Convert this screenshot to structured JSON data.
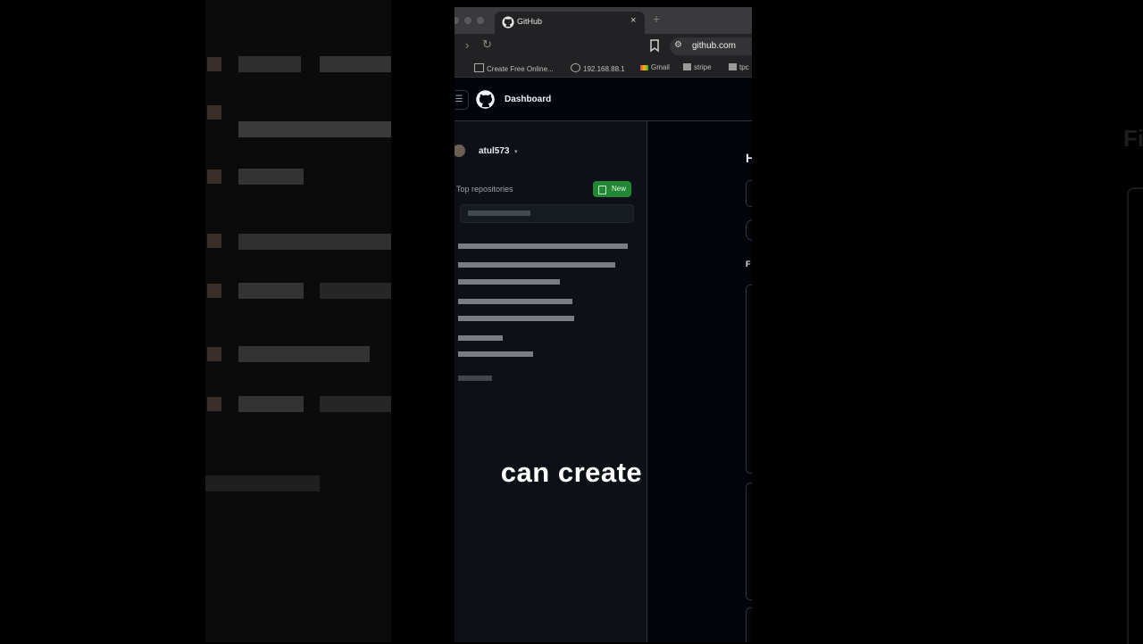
{
  "browser": {
    "tab_title": "GitHub",
    "tab_close": "×",
    "new_tab": "+",
    "forward": "›",
    "reload": "↻",
    "url": "github.com",
    "url_icon": "⚙",
    "bookmarks": [
      {
        "label": "Create Free Online...",
        "icon": "page-icon"
      },
      {
        "label": "192.168.88.1",
        "icon": "globe-icon"
      },
      {
        "label": "Gmail",
        "icon": "gmail-icon"
      },
      {
        "label": "stripe",
        "icon": "folder-icon"
      },
      {
        "label": "tpc",
        "icon": "folder-icon"
      }
    ]
  },
  "header": {
    "menu": "☰",
    "title": "Dashboard"
  },
  "sidebar": {
    "username": "atul573",
    "caret": "▾",
    "repos_label": "Top repositories",
    "new_button": "New"
  },
  "main": {
    "heading_initial": "H",
    "feed_initial": "F"
  },
  "caption": "can create",
  "side_right_text": "Fi",
  "colors": {
    "accent_green": "#238636",
    "background": "#0d1117",
    "header": "#010409"
  }
}
